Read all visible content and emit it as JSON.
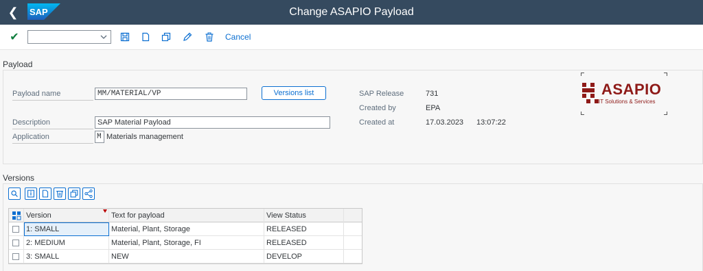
{
  "shell": {
    "title": "Change ASAPIO Payload",
    "logo_text": "SAP",
    "brand_color": "#354a5f"
  },
  "toolbar": {
    "command_field_value": "",
    "cancel_label": "Cancel",
    "icons": [
      "checkmark-icon",
      "save-icon",
      "new-document-icon",
      "copy-icon",
      "edit-icon",
      "delete-icon"
    ]
  },
  "payload_section": {
    "title": "Payload",
    "payload_name_label": "Payload name",
    "payload_name_value": "MM/MATERIAL/VP",
    "versions_list_label": "Versions list",
    "description_label": "Description",
    "description_value": "SAP Material Payload",
    "application_label": "Application",
    "application_code": "M",
    "application_text": "Materials management",
    "sap_release_label": "SAP Release",
    "sap_release_value": "731",
    "created_by_label": "Created by",
    "created_by_value": "EPA",
    "created_at_label": "Created at",
    "created_at_date": "17.03.2023",
    "created_at_time": "13:07:22"
  },
  "logo": {
    "name": "ASAPIO",
    "tagline": "IT Solutions & Services",
    "color": "#8e1a18"
  },
  "versions_section": {
    "title": "Versions",
    "tool_icons": [
      "search-icon",
      "details-icon",
      "new-document-icon",
      "delete-icon",
      "copy-icon",
      "share-icon"
    ],
    "columns": [
      "Version",
      "Text for payload",
      "View Status"
    ],
    "rows": [
      {
        "version": "1: SMALL",
        "text": "Material, Plant, Storage",
        "status": "RELEASED"
      },
      {
        "version": "2: MEDIUM",
        "text": "Material, Plant, Storage, FI",
        "status": "RELEASED"
      },
      {
        "version": "3: SMALL",
        "text": "NEW",
        "status": "DEVELOP"
      }
    ]
  }
}
